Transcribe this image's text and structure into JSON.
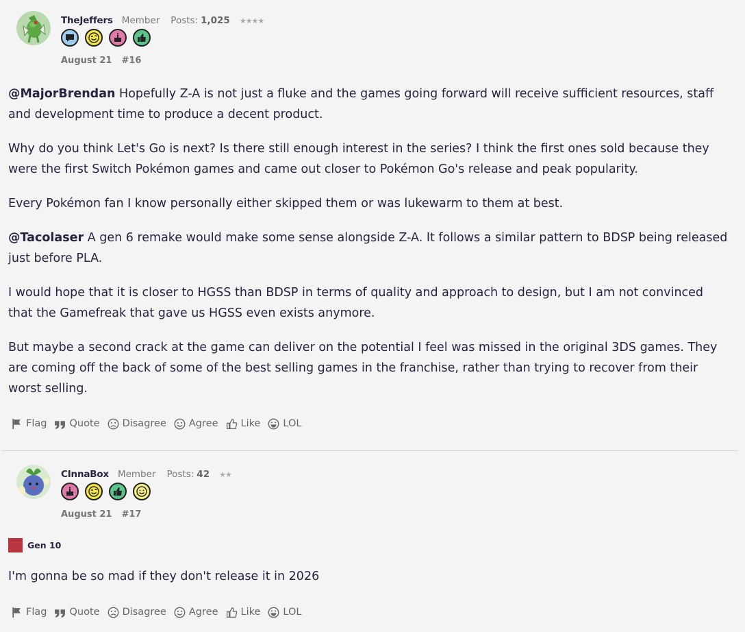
{
  "posts": [
    {
      "username": "TheJeffers",
      "role": "Member",
      "posts_label": "Posts:",
      "posts_count": "1,025",
      "stars": "★★★★",
      "badges": [
        "speech-bubble",
        "wink",
        "cake",
        "thumbs-up"
      ],
      "date": "August 21",
      "number": "#16",
      "body": {
        "p1_mention": "@MajorBrendan",
        "p1_text": " Hopefully Z-A is not just a fluke and the games going forward will receive sufficient resources, staff and development time to produce a decent product.",
        "p2": "Why do you think Let's Go is next? Is there still enough interest in the series? I think the first ones sold because they were the first Switch Pokémon games and came out closer to Pokémon Go's release and peak popularity.",
        "p3": "Every Pokémon fan I know personally either skipped them or was lukewarm to them at best.",
        "p4_mention": "@Tacolaser",
        "p4_text": " A gen 6 remake would make some sense alongside Z-A. It follows a similar pattern to BDSP being released just before PLA.",
        "p5": "I would hope that it is closer to HGSS than BDSP in terms of quality and approach to design, but I am not convinced that the Gamefreak that gave us HGSS even exists anymore.",
        "p6": "But maybe a second crack at the game can deliver on the potential I feel was missed in the original 3DS games. They are coming off the back of some of the best selling games in the franchise, rather than trying to recover from their worst selling."
      }
    },
    {
      "username": "CInnaBox",
      "role": "Member",
      "posts_label": "Posts:",
      "posts_count": "42",
      "stars": "★★",
      "badges": [
        "cake",
        "wink",
        "thumbs-up",
        "smile"
      ],
      "date": "August 21",
      "number": "#17",
      "flair": "Gen 10",
      "body": {
        "p1": "I'm gonna be so mad if they don't release it in 2026"
      }
    }
  ],
  "actions": {
    "flag": "Flag",
    "quote": "Quote",
    "disagree": "Disagree",
    "agree": "Agree",
    "like": "Like",
    "lol": "LOL"
  },
  "colors": {
    "background": "#f4f4f4",
    "text": "#2a2340",
    "muted": "#777777",
    "badge_speech": "#9ecff0",
    "badge_wink": "#f2e64a",
    "badge_cake": "#e07aa8",
    "badge_thumb": "#5cc48a",
    "badge_smile": "#f7f08a",
    "flair": "#b8343f"
  }
}
